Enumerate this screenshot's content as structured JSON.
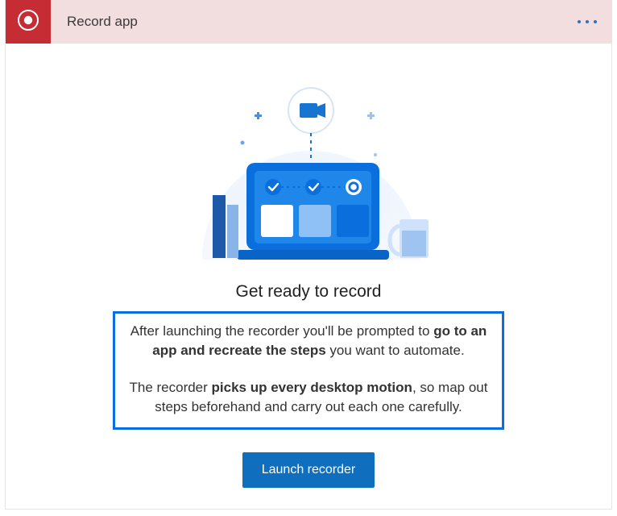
{
  "header": {
    "title": "Record app",
    "app_icon": "record-icon",
    "menu_icon": "more-dots-icon"
  },
  "main": {
    "heading": "Get ready to record",
    "para1_part1": "After launching the recorder you'll be prompted to ",
    "para1_bold": "go to an app and recreate the steps",
    "para1_part2": " you want to automate.",
    "para2_part1": "The recorder ",
    "para2_bold": "picks up every desktop motion",
    "para2_part2": ", so map out steps beforehand and carry out each one carefully.",
    "launch_label": "Launch recorder"
  },
  "colors": {
    "accent": "#106ebe",
    "header_bg": "#f2dedf",
    "header_icon_bg": "#c62c33",
    "highlight_border": "#0a6fdc"
  }
}
